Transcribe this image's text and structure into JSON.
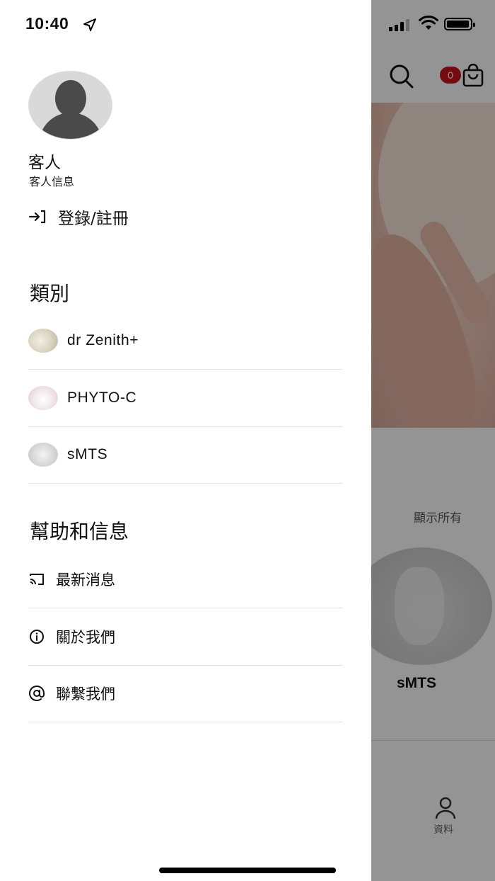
{
  "status_bar": {
    "time": "10:40"
  },
  "background": {
    "cart_count": "0",
    "see_all": "顯示所有",
    "category_label": "sMTS",
    "tab_profile_label": "資料"
  },
  "drawer": {
    "user": {
      "name": "客人",
      "subtitle": "客人信息"
    },
    "login_label": "登錄/註冊",
    "categories_title": "類別",
    "categories": [
      {
        "label": "dr Zenith+",
        "icon": "product-thumbnail"
      },
      {
        "label": "PHYTO-C",
        "icon": "product-thumbnail"
      },
      {
        "label": "sMTS",
        "icon": "product-thumbnail"
      }
    ],
    "help_title": "幫助和信息",
    "help_items": [
      {
        "label": "最新消息",
        "icon": "cast-icon"
      },
      {
        "label": "關於我們",
        "icon": "info-icon"
      },
      {
        "label": "聯繫我們",
        "icon": "at-sign-icon"
      }
    ]
  }
}
